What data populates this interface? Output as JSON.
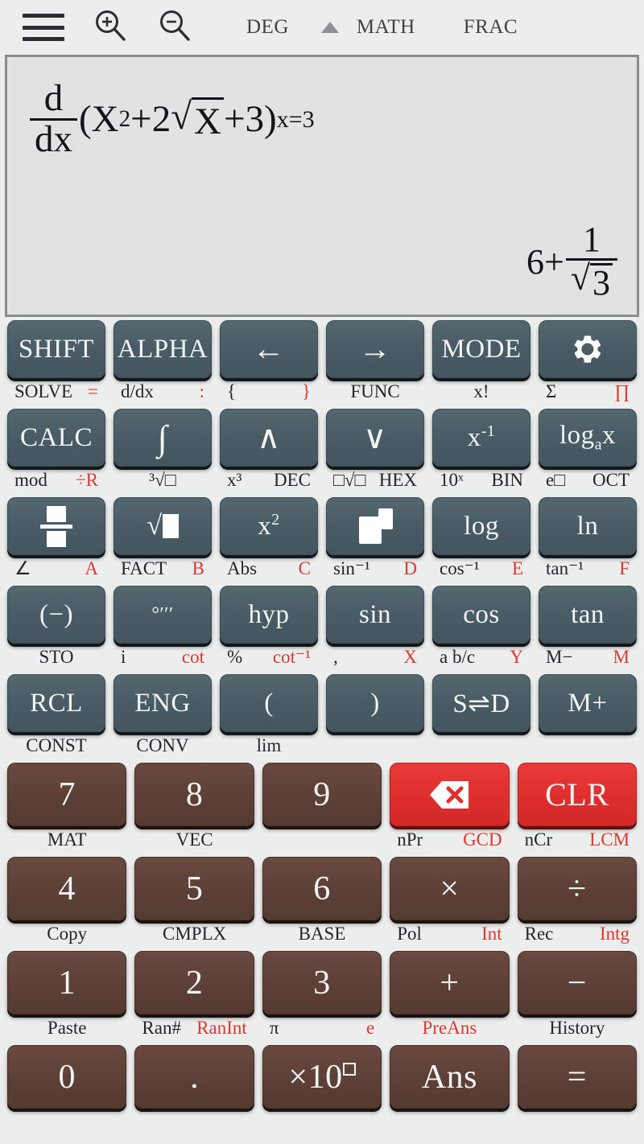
{
  "topbar": {
    "menu_icon": "hamburger-menu-icon",
    "zoom_in_icon": "zoom-in-icon",
    "zoom_out_icon": "zoom-out-icon",
    "status": {
      "angle_mode": "DEG",
      "indicator_icon": "triangle-up-icon",
      "input_mode": "MATH",
      "result_mode": "FRAC"
    }
  },
  "display": {
    "expression": {
      "operator_num": "d",
      "operator_den": "dx",
      "open_paren": "(",
      "term1_base": "X",
      "term1_exp": "2",
      "plus1": "+",
      "coef": "2",
      "radicand": "X",
      "plus2": "+",
      "term3": "3",
      "close_paren": ")",
      "subscript": "x=3"
    },
    "result": {
      "integer_part": "6+",
      "numerator": "1",
      "denominator_radicand": "3"
    }
  },
  "keypad": {
    "rows": [
      {
        "type": "function",
        "keys": [
          {
            "label": "SHIFT",
            "sub_left": "SOLVE",
            "sub_right": "="
          },
          {
            "label": "ALPHA",
            "sub_left": "d/dx",
            "sub_right": ":"
          },
          {
            "label": "left-arrow",
            "sub_left": "{",
            "sub_right": "}"
          },
          {
            "label": "right-arrow",
            "sub_left": "FUNC",
            "sub_right": ""
          },
          {
            "label": "MODE",
            "sub_left": "x!",
            "sub_right": ""
          },
          {
            "label": "gear",
            "sub_left": "Σ",
            "sub_right": "∏"
          }
        ]
      },
      {
        "type": "function",
        "keys": [
          {
            "label": "CALC",
            "sub_left": "mod",
            "sub_right": "÷R"
          },
          {
            "label": "integral",
            "sub_left": "³√□",
            "sub_right": ""
          },
          {
            "label": "up-arrow",
            "sub_left": "x³",
            "sub_right": "DEC"
          },
          {
            "label": "down-arrow",
            "sub_left": "□√□",
            "sub_right": "HEX"
          },
          {
            "label": "x-inverse",
            "sub_left": "10ˣ",
            "sub_right": "BIN"
          },
          {
            "label": "log-a-x",
            "sub_left": "e□",
            "sub_right": "OCT"
          }
        ]
      },
      {
        "type": "function",
        "keys": [
          {
            "label": "fraction",
            "sub_left": "∠",
            "sub_right": "A"
          },
          {
            "label": "sqrt",
            "sub_left": "FACT",
            "sub_right": "B"
          },
          {
            "label": "x-squared",
            "sub_left": "Abs",
            "sub_right": "C"
          },
          {
            "label": "power",
            "sub_left": "sin⁻¹",
            "sub_right": "D"
          },
          {
            "label": "log",
            "sub_left": "cos⁻¹",
            "sub_right": "E"
          },
          {
            "label": "ln",
            "sub_left": "tan⁻¹",
            "sub_right": "F"
          }
        ]
      },
      {
        "type": "function",
        "keys": [
          {
            "label": "(−)",
            "sub_left": "STO",
            "sub_right": ""
          },
          {
            "label": "degree-minute-second",
            "sub_left": "i",
            "sub_right": "cot"
          },
          {
            "label": "hyp",
            "sub_left": "%",
            "sub_right": "cot⁻¹"
          },
          {
            "label": "sin",
            "sub_left": ",",
            "sub_right": "X"
          },
          {
            "label": "cos",
            "sub_left": "a b/c",
            "sub_right": "Y"
          },
          {
            "label": "tan",
            "sub_left": "M−",
            "sub_right": "M"
          }
        ]
      },
      {
        "type": "function",
        "keys": [
          {
            "label": "RCL",
            "sub_left": "CONST",
            "sub_right": ""
          },
          {
            "label": "ENG",
            "sub_left": "CONV",
            "sub_right": ""
          },
          {
            "label": "(",
            "sub_left": "lim",
            "sub_right": ""
          },
          {
            "label": ")",
            "sub_left": "",
            "sub_right": ""
          },
          {
            "label": "S⇌D",
            "sub_left": "",
            "sub_right": ""
          },
          {
            "label": "M+",
            "sub_left": "",
            "sub_right": ""
          }
        ]
      },
      {
        "type": "number",
        "keys": [
          {
            "label": "7",
            "color": "brown",
            "sub_left": "MAT",
            "sub_right": ""
          },
          {
            "label": "8",
            "color": "brown",
            "sub_left": "VEC",
            "sub_right": ""
          },
          {
            "label": "9",
            "color": "brown",
            "sub_left": "",
            "sub_right": ""
          },
          {
            "label": "delete",
            "color": "red",
            "sub_left": "nPr",
            "sub_right": "GCD"
          },
          {
            "label": "CLR",
            "color": "red",
            "sub_left": "nCr",
            "sub_right": "LCM"
          }
        ]
      },
      {
        "type": "number",
        "keys": [
          {
            "label": "4",
            "color": "brown",
            "sub_left": "Copy",
            "sub_right": ""
          },
          {
            "label": "5",
            "color": "brown",
            "sub_left": "CMPLX",
            "sub_right": ""
          },
          {
            "label": "6",
            "color": "brown",
            "sub_left": "BASE",
            "sub_right": ""
          },
          {
            "label": "×",
            "color": "brown",
            "sub_left": "Pol",
            "sub_right": "Int"
          },
          {
            "label": "÷",
            "color": "brown",
            "sub_left": "Rec",
            "sub_right": "Intg"
          }
        ]
      },
      {
        "type": "number",
        "keys": [
          {
            "label": "1",
            "color": "brown",
            "sub_left": "Paste",
            "sub_right": ""
          },
          {
            "label": "2",
            "color": "brown",
            "sub_left": "Ran#",
            "sub_right": "RanInt"
          },
          {
            "label": "3",
            "color": "brown",
            "sub_left": "π",
            "sub_right": "e"
          },
          {
            "label": "+",
            "color": "brown",
            "sub_left": "",
            "sub_right": "PreAns"
          },
          {
            "label": "−",
            "color": "brown",
            "sub_left": "History",
            "sub_right": ""
          }
        ]
      },
      {
        "type": "number",
        "keys": [
          {
            "label": "0",
            "color": "brown",
            "sub_left": "",
            "sub_right": ""
          },
          {
            "label": ".",
            "color": "brown",
            "sub_left": "",
            "sub_right": ""
          },
          {
            "label": "times-ten-power",
            "color": "brown",
            "sub_left": "",
            "sub_right": ""
          },
          {
            "label": "Ans",
            "color": "brown",
            "sub_left": "",
            "sub_right": ""
          },
          {
            "label": "=",
            "color": "brown",
            "sub_left": "",
            "sub_right": ""
          }
        ]
      }
    ]
  },
  "colors": {
    "function_key": "#4a5d66",
    "number_key": "#5d4037",
    "action_key": "#df2f2f",
    "background": "#eceded",
    "display_bg": "#e1e2e2",
    "alt_label": "#e0372f"
  }
}
